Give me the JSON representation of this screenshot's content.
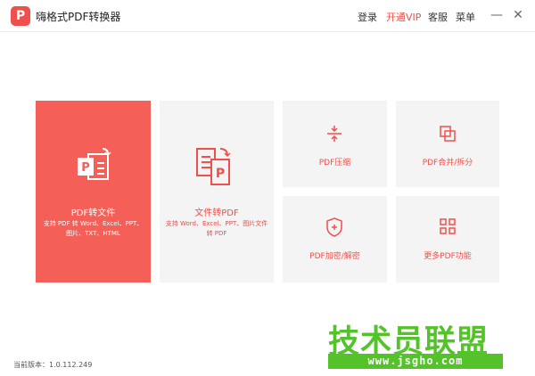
{
  "titlebar": {
    "logo_glyph": "P",
    "app_title": "嗨格式PDF转换器",
    "menu": {
      "login": "登录",
      "vip": "开通VIP",
      "service": "客服",
      "more": "菜单"
    },
    "min_glyph": "—",
    "close_glyph": "✕"
  },
  "tiles": {
    "pdf_to_file": {
      "title": "PDF转文件",
      "desc": "支持 PDF 转 Word、Excel、PPT、图片、TXT、HTML",
      "icon": "pdf-to-file-icon"
    },
    "file_to_pdf": {
      "title": "文件转PDF",
      "desc": "支持 Word、Excel、PPT、图片文件转 PDF",
      "icon": "file-to-pdf-icon"
    },
    "compress": {
      "title": "PDF压缩",
      "icon": "compress-icon"
    },
    "merge_split": {
      "title": "PDF合并/拆分",
      "icon": "merge-split-icon"
    },
    "encrypt": {
      "title": "PDF加密/解密",
      "icon": "shield-icon"
    },
    "more": {
      "title": "更多PDF功能",
      "icon": "grid-icon"
    }
  },
  "footer": {
    "version": "当前版本：1.0.112.249"
  },
  "watermark": {
    "text": "技术员联盟",
    "url": "www.jsgho.com"
  },
  "colors": {
    "accent": "#f0504b",
    "tile_bg": "#f4f4f4",
    "tile_red": "#f45f58",
    "watermark": "#54c32a"
  }
}
